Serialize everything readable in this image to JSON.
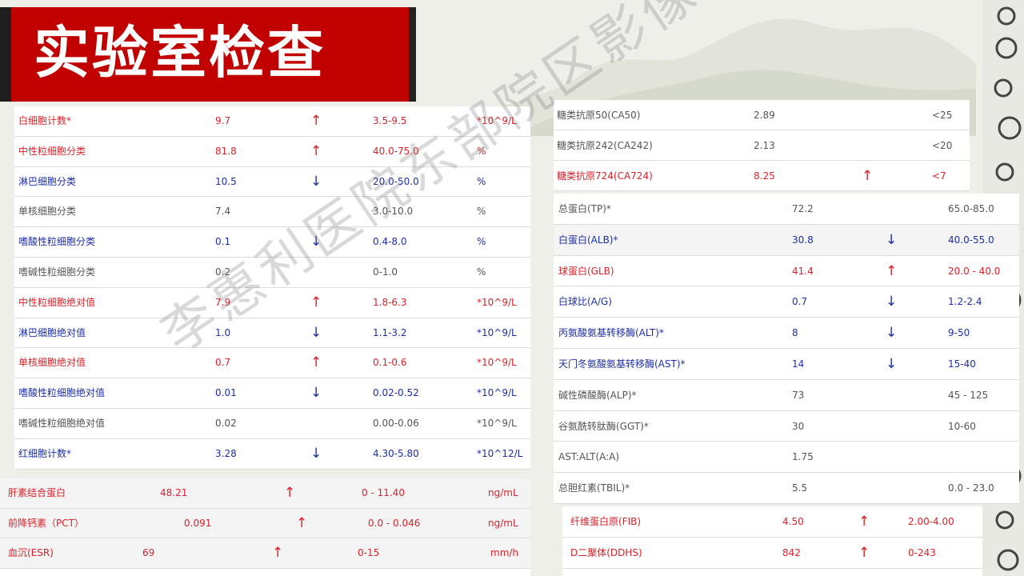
{
  "title": "实验室检查",
  "watermark": "李惠利医院东部院区影像科",
  "blood_routine": [
    {
      "name": "白细胞计数*",
      "value": "9.7",
      "flag": "↑",
      "range": "3.5-9.5",
      "unit": "*10^9/L",
      "color": "red"
    },
    {
      "name": "中性粒细胞分类",
      "value": "81.8",
      "flag": "↑",
      "range": "40.0-75.0",
      "unit": "%",
      "color": "red"
    },
    {
      "name": "淋巴细胞分类",
      "value": "10.5",
      "flag": "↓",
      "range": "20.0-50.0",
      "unit": "%",
      "color": "blue"
    },
    {
      "name": "单核细胞分类",
      "value": "7.4",
      "flag": "",
      "range": "3.0-10.0",
      "unit": "%",
      "color": "gray"
    },
    {
      "name": "嗜酸性粒细胞分类",
      "value": "0.1",
      "flag": "↓",
      "range": "0.4-8.0",
      "unit": "%",
      "color": "blue"
    },
    {
      "name": "嗜碱性粒细胞分类",
      "value": "0.2",
      "flag": "",
      "range": "0-1.0",
      "unit": "%",
      "color": "gray"
    },
    {
      "name": "中性粒细胞绝对值",
      "value": "7.9",
      "flag": "↑",
      "range": "1.8-6.3",
      "unit": "*10^9/L",
      "color": "red"
    },
    {
      "name": "淋巴细胞绝对值",
      "value": "1.0",
      "flag": "↓",
      "range": "1.1-3.2",
      "unit": "*10^9/L",
      "color": "blue"
    },
    {
      "name": "单核细胞绝对值",
      "value": "0.7",
      "flag": "↑",
      "range": "0.1-0.6",
      "unit": "*10^9/L",
      "color": "red"
    },
    {
      "name": "嗜酸性粒细胞绝对值",
      "value": "0.01",
      "flag": "↓",
      "range": "0.02-0.52",
      "unit": "*10^9/L",
      "color": "blue"
    },
    {
      "name": "嗜碱性粒细胞绝对值",
      "value": "0.02",
      "flag": "",
      "range": "0.00-0.06",
      "unit": "*10^9/L",
      "color": "gray"
    },
    {
      "name": "红细胞计数*",
      "value": "3.28",
      "flag": "↓",
      "range": "4.30-5.80",
      "unit": "*10^12/L",
      "color": "blue"
    }
  ],
  "inflammation": [
    {
      "name": "肝素结合蛋白",
      "value": "48.21",
      "flag": "↑",
      "range": "0 - 11.40",
      "unit": "ng/mL"
    },
    {
      "name": "前降钙素（PCT）",
      "value": "0.091",
      "flag": "↑",
      "range": "0.0 - 0.046",
      "unit": "ng/mL"
    },
    {
      "name": "血沉(ESR)",
      "value": "69",
      "flag": "↑",
      "range": "0-15",
      "unit": "mm/h"
    }
  ],
  "tumor_markers": [
    {
      "name": "糖类抗原50(CA50)",
      "value": "2.89",
      "flag": "",
      "range": "<25",
      "color": "gray"
    },
    {
      "name": "糖类抗原242(CA242)",
      "value": "2.13",
      "flag": "",
      "range": "<20",
      "color": "gray"
    },
    {
      "name": "糖类抗原724(CA724)",
      "value": "8.25",
      "flag": "↑",
      "range": "<7",
      "color": "red"
    }
  ],
  "liver_function": [
    {
      "name": "总蛋白(TP)*",
      "value": "72.2",
      "flag": "",
      "range": "65.0-85.0",
      "color": "gray"
    },
    {
      "name": "白蛋白(ALB)*",
      "value": "30.8",
      "flag": "↓",
      "range": "40.0-55.0",
      "color": "blue"
    },
    {
      "name": "球蛋白(GLB)",
      "value": "41.4",
      "flag": "↑",
      "range": "20.0 - 40.0",
      "color": "red"
    },
    {
      "name": "白球比(A/G)",
      "value": "0.7",
      "flag": "↓",
      "range": "1.2-2.4",
      "color": "blue"
    },
    {
      "name": "丙氨酸氨基转移酶(ALT)*",
      "value": "8",
      "flag": "↓",
      "range": "9-50",
      "color": "blue"
    },
    {
      "name": "天门冬氨酸氨基转移酶(AST)*",
      "value": "14",
      "flag": "↓",
      "range": "15-40",
      "color": "blue"
    },
    {
      "name": "碱性磷酸酶(ALP)*",
      "value": "73",
      "flag": "",
      "range": "45 - 125",
      "color": "gray"
    },
    {
      "name": "谷氨酰转肽酶(GGT)*",
      "value": "30",
      "flag": "",
      "range": "10-60",
      "color": "gray"
    },
    {
      "name": "AST:ALT(A:A)",
      "value": "1.75",
      "flag": "",
      "range": "",
      "color": "gray"
    },
    {
      "name": "总胆红素(TBIL)*",
      "value": "5.5",
      "flag": "",
      "range": "0.0 - 23.0",
      "color": "gray"
    }
  ],
  "coagulation": [
    {
      "name": "纤维蛋白原(FIB)",
      "value": "4.50",
      "flag": "↑",
      "range": "2.00-4.00"
    },
    {
      "name": "D二聚体(DDHS)",
      "value": "842",
      "flag": "↑",
      "range": "0-243"
    }
  ],
  "colors": {
    "red": "#d9222a",
    "blue": "#1d2fa8",
    "gray": "#555555",
    "title_bg": "#c10000"
  }
}
